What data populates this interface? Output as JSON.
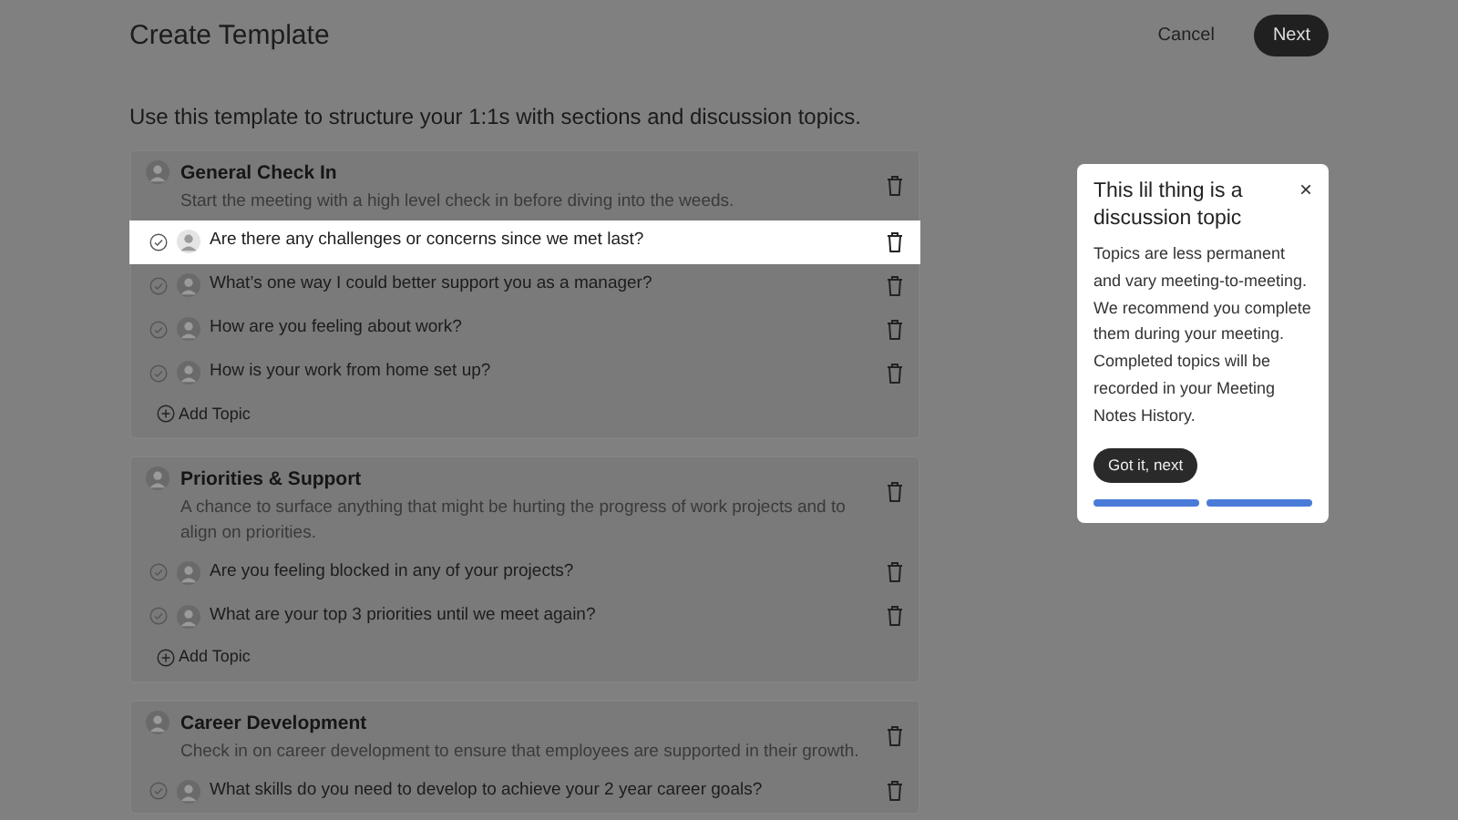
{
  "header": {
    "title": "Create Template",
    "cancel": "Cancel",
    "next": "Next"
  },
  "intro": "Use this template to structure your 1:1s with sections and discussion topics.",
  "sections": [
    {
      "title": "General Check In",
      "description": "Start the meeting with a high level check in before diving into the weeds.",
      "topics": [
        {
          "text": "Are there any challenges or concerns since we met last?",
          "highlighted": true
        },
        {
          "text": "What’s one way I could better support you as a manager?",
          "highlighted": false
        },
        {
          "text": "How are you feeling about work?",
          "highlighted": false
        },
        {
          "text": "How is your work from home set up?",
          "highlighted": false
        }
      ],
      "add_label": "Add Topic"
    },
    {
      "title": "Priorities & Support",
      "description": "A chance to surface anything that might be hurting the progress of work projects and to align on priorities.",
      "topics": [
        {
          "text": "Are you feeling blocked in any of your projects?",
          "highlighted": false
        },
        {
          "text": "What are your top 3 priorities until we meet again?",
          "highlighted": false
        }
      ],
      "add_label": "Add Topic"
    },
    {
      "title": "Career Development",
      "description": "Check in on career development to ensure that employees are supported in their growth.",
      "topics": [
        {
          "text": "What skills do you need to develop to achieve your 2 year career goals?",
          "highlighted": false
        }
      ]
    }
  ],
  "popover": {
    "title": "This lil thing is a discussion topic",
    "close": "×",
    "body": "Topics are less permanent and vary meeting-to-meeting. We recommend you complete them during your meeting. Completed topics will be recorded in your Meeting Notes History.",
    "button": "Got it, next",
    "steps": [
      {
        "done": true
      },
      {
        "done": true
      }
    ]
  }
}
